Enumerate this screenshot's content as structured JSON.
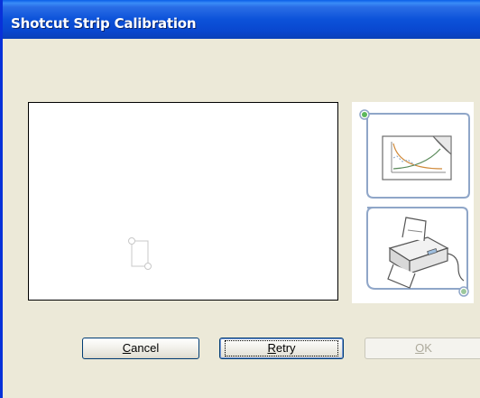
{
  "window": {
    "title": "Shotcut Strip Calibration"
  },
  "icons": {
    "preview_handle": "crop-rectangle-icon",
    "chart": "curve-chart-icon",
    "printer": "printer-icon"
  },
  "buttons": {
    "cancel": {
      "accel": "C",
      "rest": "ancel",
      "enabled": true
    },
    "retry": {
      "accel": "R",
      "rest": "etry",
      "enabled": true,
      "default": true
    },
    "ok": {
      "accel": "O",
      "rest": "K",
      "enabled": false
    }
  },
  "colors": {
    "titlebar": "#0c52d9",
    "window_bg": "#ece9d8",
    "panel_outline": "#8fa6c8",
    "dot_green": "#5cb85c"
  }
}
